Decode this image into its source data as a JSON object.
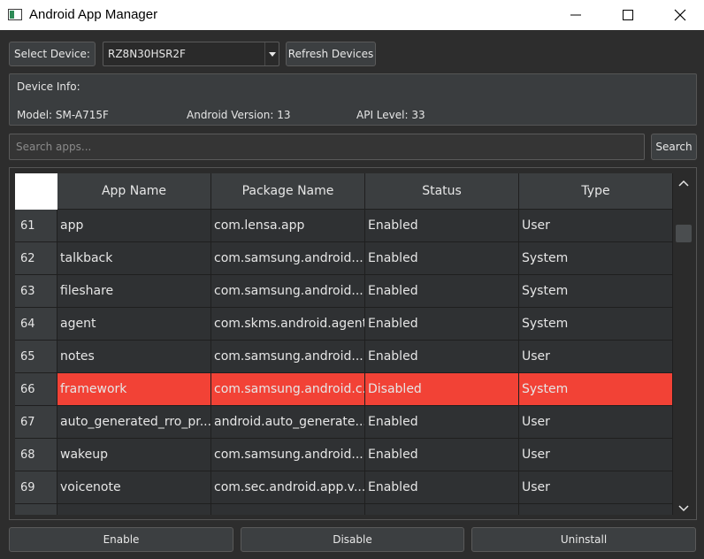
{
  "window": {
    "title": "Android App Manager"
  },
  "device_bar": {
    "select_label": "Select Device:",
    "selected_device": "RZ8N30HSR2F",
    "refresh_label": "Refresh Devices"
  },
  "device_info": {
    "title": "Device Info:",
    "model": "Model: SM-A715F",
    "android_version": "Android Version: 13",
    "api_level": "API Level: 33"
  },
  "search": {
    "placeholder": "Search apps...",
    "value": "",
    "button_label": "Search"
  },
  "table": {
    "columns": [
      "App Name",
      "Package Name",
      "Status",
      "Type"
    ],
    "selected_row_color": "#f24236",
    "rows": [
      {
        "num": "61",
        "app": "app",
        "package": "com.lensa.app",
        "status": "Enabled",
        "type": "User"
      },
      {
        "num": "62",
        "app": "talkback",
        "package": "com.samsung.android....",
        "status": "Enabled",
        "type": "System"
      },
      {
        "num": "63",
        "app": "fileshare",
        "package": "com.samsung.android....",
        "status": "Enabled",
        "type": "System"
      },
      {
        "num": "64",
        "app": "agent",
        "package": "com.skms.android.agent",
        "status": "Enabled",
        "type": "System"
      },
      {
        "num": "65",
        "app": "notes",
        "package": "com.samsung.android....",
        "status": "Enabled",
        "type": "User"
      },
      {
        "num": "66",
        "app": "framework",
        "package": "com.samsung.android.c...",
        "status": "Disabled",
        "type": "System"
      },
      {
        "num": "67",
        "app": "auto_generated_rro_pr...",
        "package": "android.auto_generate...",
        "status": "Enabled",
        "type": "User"
      },
      {
        "num": "68",
        "app": "wakeup",
        "package": "com.samsung.android....",
        "status": "Enabled",
        "type": "User"
      },
      {
        "num": "69",
        "app": "voicenote",
        "package": "com.sec.android.app.v...",
        "status": "Enabled",
        "type": "User"
      }
    ],
    "selected_index": 5
  },
  "actions": {
    "enable_label": "Enable",
    "disable_label": "Disable",
    "uninstall_label": "Uninstall"
  }
}
